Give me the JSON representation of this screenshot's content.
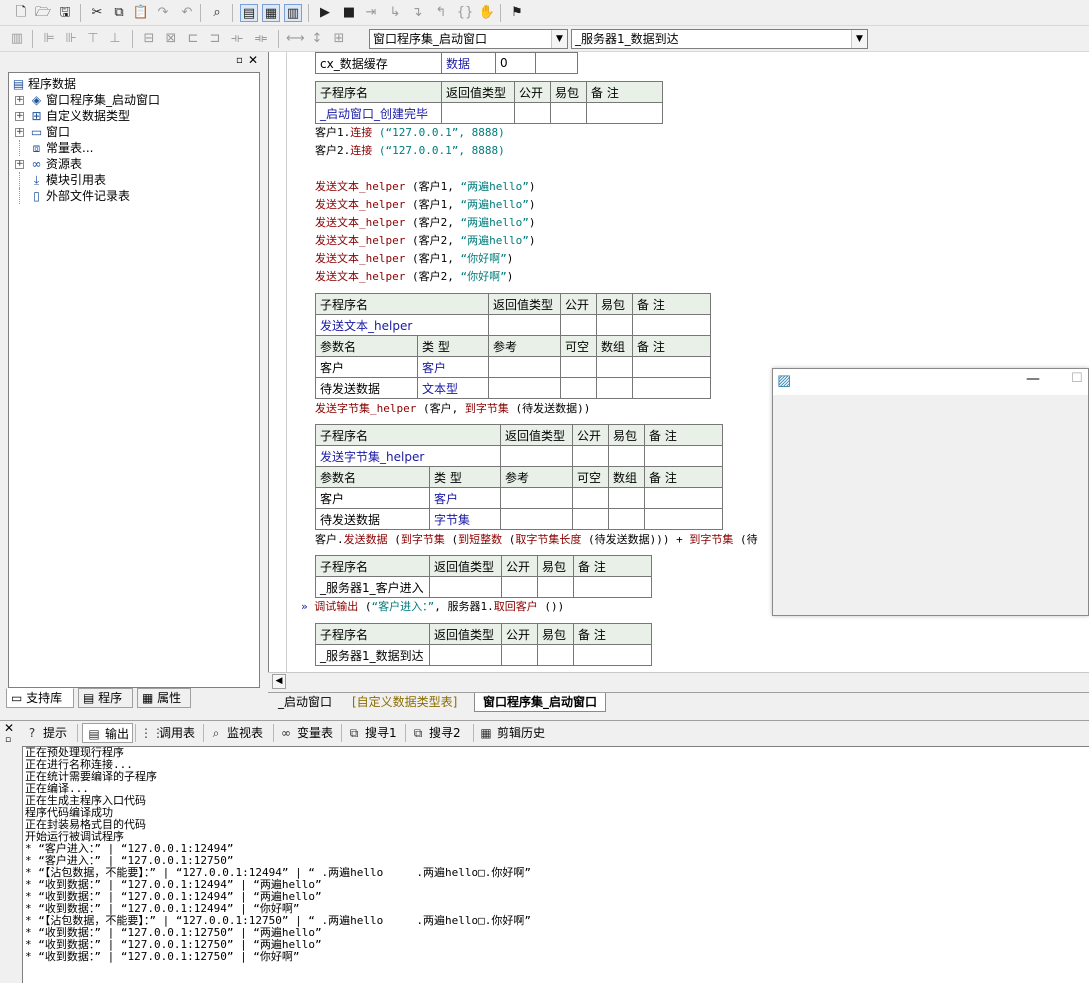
{
  "toolbar1": {
    "icons": [
      "new-file-icon",
      "open-folder-icon",
      "save-icon",
      "cut-icon",
      "copy-icon",
      "paste-icon",
      "redo-icon",
      "undo-icon",
      "find-icon",
      "layout1-icon",
      "layout2-icon",
      "layout3-icon",
      "run-icon",
      "stop-icon",
      "step-icon",
      "step-into-icon",
      "step-over-icon",
      "step-out-icon",
      "braces-icon",
      "hand-icon",
      "debug-icon"
    ],
    "glyphs": [
      "🗋",
      "🗁",
      "🖫",
      "✂",
      "⧉",
      "📋",
      "↷",
      "↶",
      "⌕",
      "▤",
      "▦",
      "▥",
      "▶",
      "■",
      "⇥",
      "↳",
      "↴",
      "↰",
      "{}",
      "✋",
      "⚑"
    ]
  },
  "toolbar2": {
    "combo_left": "窗口程序集_启动窗口",
    "combo_right": "_服务器1_数据到达"
  },
  "tree": {
    "title": "程序数据",
    "items": [
      {
        "label": "窗口程序集_启动窗口",
        "icon": "layers-icon",
        "glyph": "◈",
        "expandable": true
      },
      {
        "label": "自定义数据类型",
        "icon": "datatype-icon",
        "glyph": "⊞",
        "expandable": true
      },
      {
        "label": "窗口",
        "icon": "window-icon",
        "glyph": "▭",
        "expandable": true
      },
      {
        "label": "常量表...",
        "icon": "constants-icon",
        "glyph": "⧈",
        "expandable": false
      },
      {
        "label": "资源表",
        "icon": "resources-icon",
        "glyph": "∞",
        "expandable": true
      },
      {
        "label": "模块引用表",
        "icon": "module-icon",
        "glyph": "⤓",
        "expandable": false
      },
      {
        "label": "外部文件记录表",
        "icon": "external-file-icon",
        "glyph": "▯",
        "expandable": false
      }
    ],
    "tabs": [
      "支持库",
      "程序",
      "属性"
    ]
  },
  "editor": {
    "var_row": {
      "name": "cx_数据缓存",
      "type": "数据",
      "value": "0"
    },
    "table_headers": {
      "sub": "子程序名",
      "ret": "返回值类型",
      "pub": "公开",
      "easy": "易包",
      "note": "备 注"
    },
    "param_headers": {
      "param": "参数名",
      "type": "类 型",
      "ref": "参考",
      "nullable": "可空",
      "array": "数组",
      "note": "备 注"
    },
    "sub1": "_启动窗口_创建完毕",
    "lines_a": [
      {
        "obj": "客户1.",
        "method": "连接",
        "args": " (“127.0.0.1”, 8888)"
      },
      {
        "obj": "客户2.",
        "method": "连接",
        "args": " (“127.0.0.1”, 8888)"
      }
    ],
    "send_lines": [
      {
        "fn": "发送文本_helper",
        "pre": " (客户1, ",
        "str": "“两遍hello”",
        "post": ")"
      },
      {
        "fn": "发送文本_helper",
        "pre": " (客户1, ",
        "str": "“两遍hello”",
        "post": ")"
      },
      {
        "fn": "发送文本_helper",
        "pre": " (客户2, ",
        "str": "“两遍hello”",
        "post": ")"
      },
      {
        "fn": "发送文本_helper",
        "pre": " (客户2, ",
        "str": "“两遍hello”",
        "post": ")"
      },
      {
        "fn": "发送文本_helper",
        "pre": " (客户1, ",
        "str": "“你好啊”",
        "post": ")"
      },
      {
        "fn": "发送文本_helper",
        "pre": " (客户2, ",
        "str": "“你好啊”",
        "post": ")"
      }
    ],
    "sub2": "发送文本_helper",
    "sub2_params": [
      {
        "name": "客户",
        "type": "客户"
      },
      {
        "name": "待发送数据",
        "type": "文本型"
      }
    ],
    "line_b": {
      "fn": "发送字节集_helper",
      "pre": " (客户, ",
      "fn2": "到字节集",
      "post": " (待发送数据))"
    },
    "sub3": "发送字节集_helper",
    "sub3_params": [
      {
        "name": "客户",
        "type": "客户"
      },
      {
        "name": "待发送数据",
        "type": "字节集"
      }
    ],
    "line_c": {
      "obj": "客户.",
      "m1": "发送数据",
      "a1": " (",
      "f1": "到字节集",
      "a2": " (",
      "f2": "到短整数",
      "a3": " (",
      "f3": "取字节集长度",
      "a4": " (待发送数据))) + ",
      "f4": "到字节集",
      "a5": " (待"
    },
    "sub4": "_服务器1_客户进入",
    "line_d": {
      "arrow": "»",
      "fn": "调试输出",
      "pre": " (",
      "str": "“客户进入：”",
      "mid": ", 服务器1.",
      "m": "取回客户",
      "post": " ())"
    },
    "sub5": "_服务器1_数据到达"
  },
  "editor_tabs": [
    "_启动窗口",
    "[自定义数据类型表]",
    "窗口程序集_启动窗口"
  ],
  "output_tabs": [
    {
      "label": "提示",
      "icon": "hint-icon",
      "glyph": "?"
    },
    {
      "label": "输出",
      "icon": "output-icon",
      "glyph": "▤"
    },
    {
      "label": "调用表",
      "icon": "callstack-icon",
      "glyph": "⋮⋮"
    },
    {
      "label": "监视表",
      "icon": "watch-icon",
      "glyph": "⌕"
    },
    {
      "label": "变量表",
      "icon": "variables-icon",
      "glyph": "∞"
    },
    {
      "label": "搜寻1",
      "icon": "search1-icon",
      "glyph": "⧉"
    },
    {
      "label": "搜寻2",
      "icon": "search2-icon",
      "glyph": "⧉"
    },
    {
      "label": "剪辑历史",
      "icon": "clip-history-icon",
      "glyph": "▦"
    }
  ],
  "output_lines": [
    "正在预处理现行程序",
    "正在进行名称连接...",
    "正在统计需要编译的子程序",
    "正在编译...",
    "正在生成主程序入口代码",
    "程序代码编译成功",
    "正在封装易格式目的代码",
    "开始运行被调试程序",
    "* “客户进入：” | “127.0.0.1:12494”",
    "* “客户进入：” | “127.0.0.1:12750”",
    "* “【沾包数据，不能要】：” | “127.0.0.1:12494” | “ .两遍hello     .两遍hello□.你好啊”",
    "* “收到数据：” | “127.0.0.1:12494” | “两遍hello”",
    "* “收到数据：” | “127.0.0.1:12494” | “两遍hello”",
    "* “收到数据：” | “127.0.0.1:12494” | “你好啊”",
    "* “【沾包数据，不能要】：” | “127.0.0.1:12750” | “ .两遍hello     .两遍hello□.你好啊”",
    "* “收到数据：” | “127.0.0.1:12750” | “两遍hello”",
    "* “收到数据：” | “127.0.0.1:12750” | “两遍hello”",
    "* “收到数据：” | “127.0.0.1:12750” | “你好啊”"
  ],
  "float_window": {
    "app_icon": "app-icon",
    "glyph": "▨",
    "min_glyph": "—",
    "max_glyph": "☐"
  }
}
